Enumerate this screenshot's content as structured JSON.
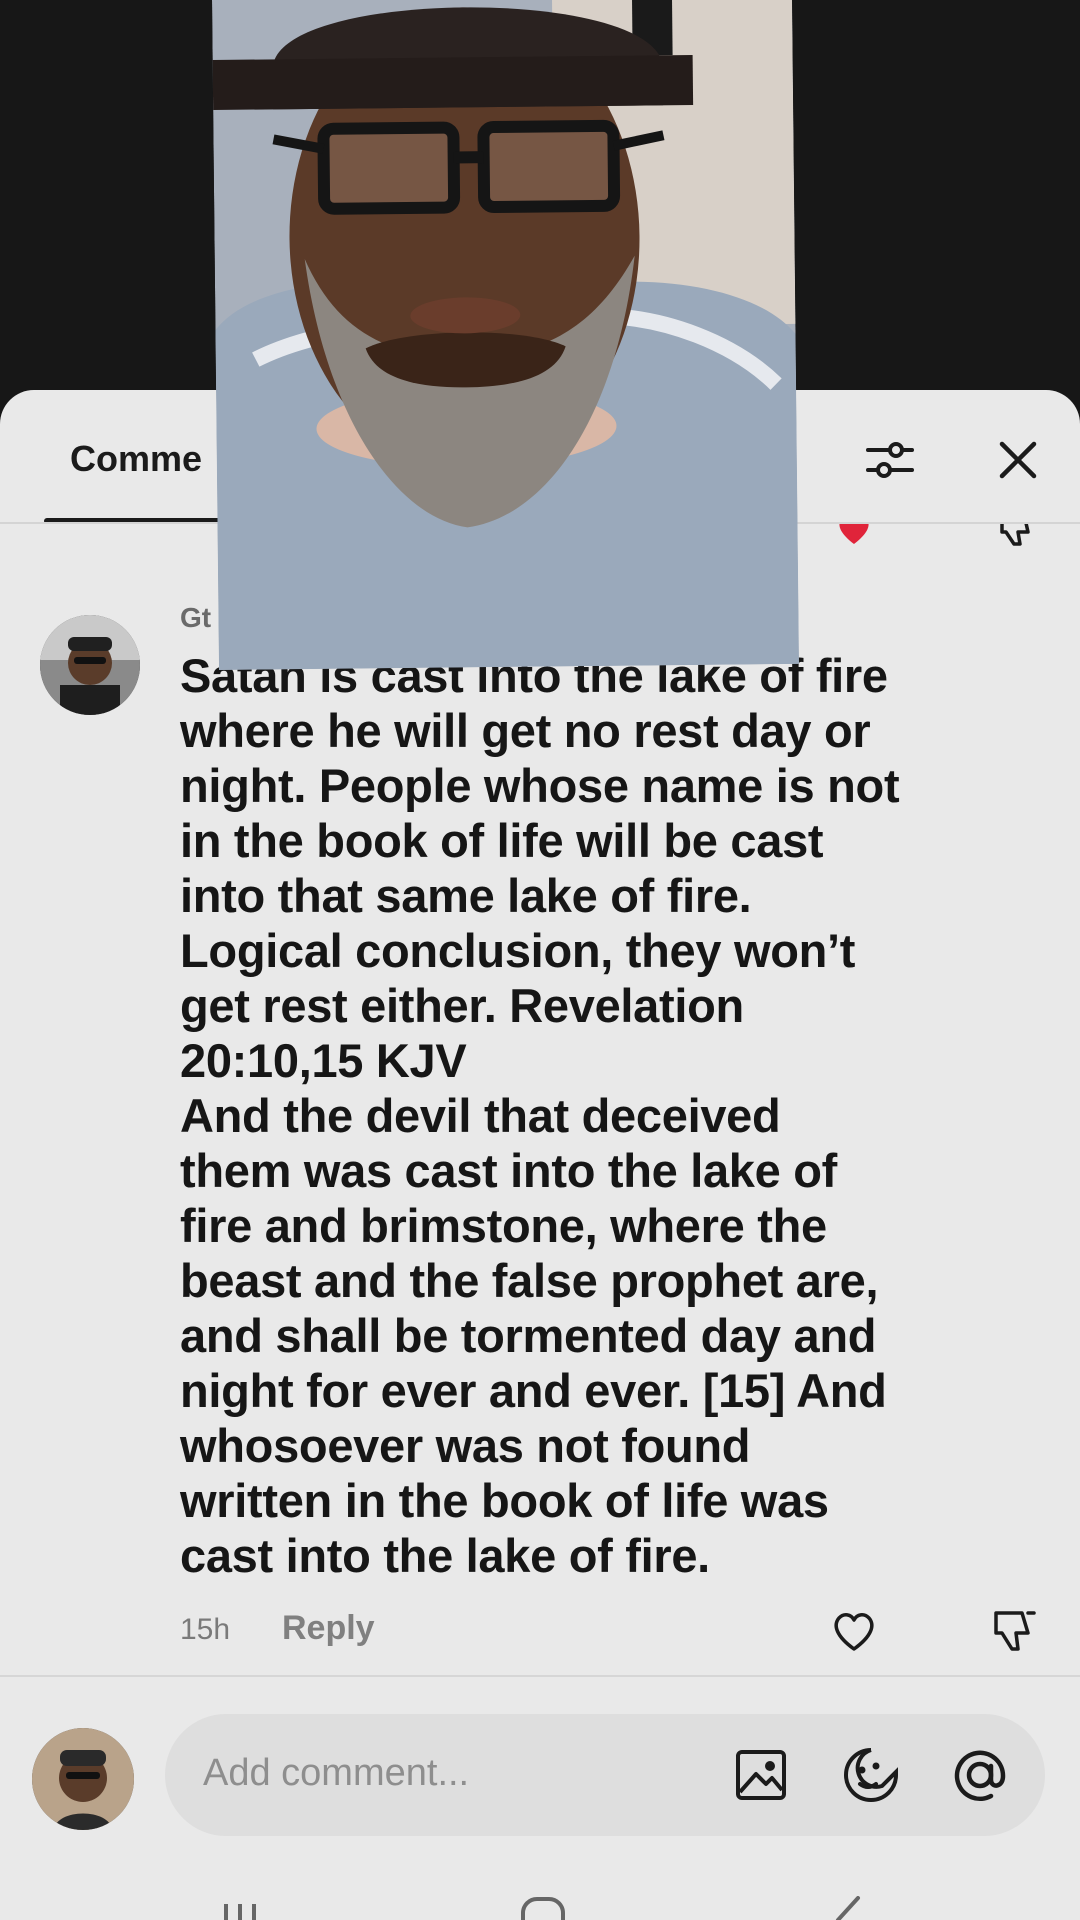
{
  "header": {
    "tab_label": "Comme"
  },
  "comment": {
    "username": "Gt",
    "body": "Satan is cast into the lake of fire\nwhere he will get no rest day or\nnight. People whose name is not\nin the book of life will be cast\ninto that same lake of fire.\nLogical conclusion, they won’t\nget rest either. Revelation\n20:10,15 KJV\nAnd the devil that deceived\nthem was cast into the lake of\nfire and brimstone, where the\nbeast and the false prophet are,\nand shall be tormented day and\nnight for ever and ever. [15] And\nwhosoever was not found\nwritten in the book of life was\ncast into the lake of fire.",
    "time": "15h",
    "reply_label": "Reply"
  },
  "composer": {
    "placeholder": "Add comment..."
  },
  "icons": {
    "filter": "sliders-icon",
    "close": "close-icon",
    "like": "heart-outline-icon",
    "dislike": "thumbs-down-icon",
    "image": "image-icon",
    "sticker": "sticker-face-icon",
    "mention": "at-sign-icon"
  },
  "colors": {
    "sheet_bg": "#e9e9e9",
    "text": "#161616",
    "muted": "#8e8e8e",
    "accent_heart": "#e0243a"
  }
}
